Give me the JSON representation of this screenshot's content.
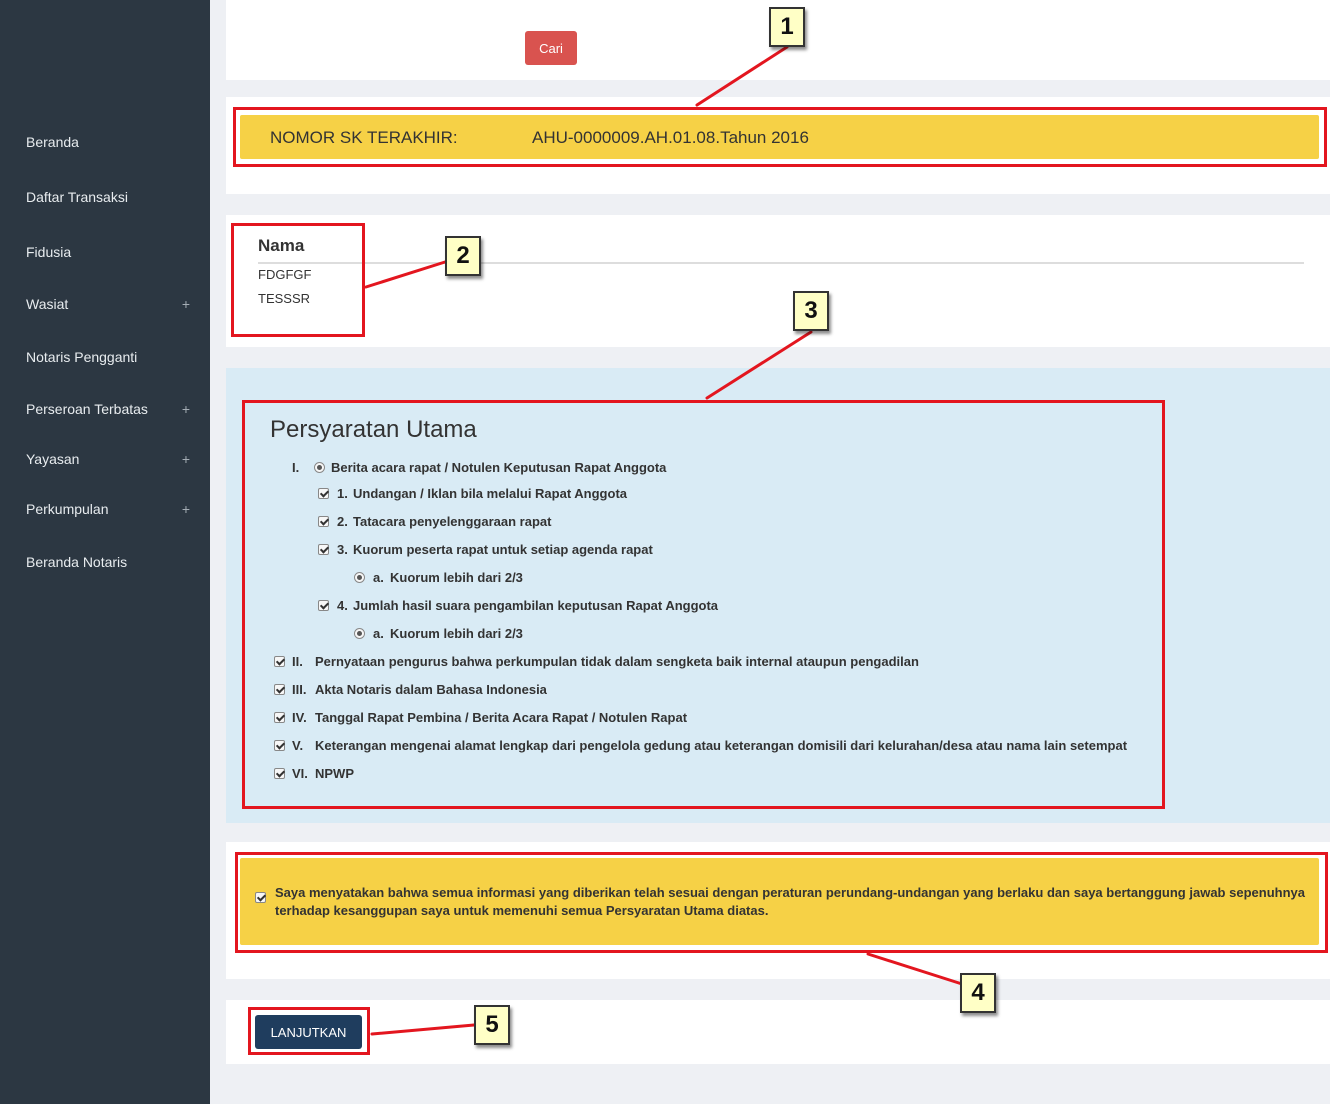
{
  "sidebar": {
    "items": [
      {
        "label": "Beranda",
        "expandable": false
      },
      {
        "label": "Daftar Transaksi",
        "expandable": false
      },
      {
        "label": "Fidusia",
        "expandable": false
      },
      {
        "label": "Wasiat",
        "expandable": true
      },
      {
        "label": "Notaris Pengganti",
        "expandable": false
      },
      {
        "label": "Perseroan Terbatas",
        "expandable": true
      },
      {
        "label": "Yayasan",
        "expandable": true
      },
      {
        "label": "Perkumpulan",
        "expandable": true
      },
      {
        "label": "Beranda Notaris",
        "expandable": false
      }
    ],
    "expand_symbol": "+"
  },
  "search": {
    "button_label": "Cari"
  },
  "sk": {
    "label": "NOMOR SK TERAKHIR:",
    "value": "AHU-0000009.AH.01.08.Tahun 2016"
  },
  "nama": {
    "header": "Nama",
    "rows": [
      "FDGFGF",
      "TESSSR"
    ]
  },
  "requirements": {
    "title": "Persyaratan Utama",
    "items": [
      {
        "control": "none",
        "number": "I.",
        "text": ""
      },
      {
        "control": "radio",
        "checked": true,
        "number": "",
        "text": "Berita acara rapat / Notulen Keputusan Rapat Anggota"
      },
      {
        "control": "checkbox",
        "checked": true,
        "number": "1.",
        "text": "Undangan / Iklan bila melalui Rapat Anggota"
      },
      {
        "control": "checkbox",
        "checked": true,
        "number": "2.",
        "text": "Tatacara penyelenggaraan rapat"
      },
      {
        "control": "checkbox",
        "checked": true,
        "number": "3.",
        "text": "Kuorum peserta rapat untuk setiap agenda rapat"
      },
      {
        "control": "radio",
        "checked": true,
        "number": "a.",
        "text": "Kuorum lebih dari 2/3"
      },
      {
        "control": "checkbox",
        "checked": true,
        "number": "4.",
        "text": "Jumlah hasil suara pengambilan keputusan Rapat Anggota"
      },
      {
        "control": "radio",
        "checked": true,
        "number": "a.",
        "text": "Kuorum lebih dari 2/3"
      },
      {
        "control": "checkbox",
        "checked": true,
        "number": "II.",
        "text": "Pernyataan pengurus bahwa perkumpulan tidak dalam sengketa baik internal ataupun pengadilan"
      },
      {
        "control": "checkbox",
        "checked": true,
        "number": "III.",
        "text": "Akta Notaris dalam Bahasa Indonesia"
      },
      {
        "control": "checkbox",
        "checked": true,
        "number": "IV.",
        "text": "Tanggal Rapat Pembina / Berita Acara Rapat / Notulen Rapat"
      },
      {
        "control": "checkbox",
        "checked": true,
        "number": "V.",
        "text": "Keterangan mengenai alamat lengkap dari pengelola gedung atau keterangan domisili dari kelurahan/desa atau nama lain setempat"
      },
      {
        "control": "checkbox",
        "checked": true,
        "number": "VI.",
        "text": "NPWP"
      }
    ]
  },
  "declaration": {
    "checked": true,
    "text": "Saya menyatakan bahwa semua informasi yang diberikan telah sesuai dengan peraturan perundang-undangan yang berlaku dan saya bertanggung jawab sepenuhnya terhadap kesanggupan saya untuk memenuhi semua Persyaratan Utama diatas."
  },
  "continue_button": {
    "label": "LANJUTKAN"
  },
  "callouts": [
    "1",
    "2",
    "3",
    "4",
    "5"
  ],
  "colors": {
    "sidebar_bg": "#2c3742",
    "warning_yellow": "#f6d146",
    "info_blue": "#d9ebf5",
    "danger_red": "#d9534f",
    "primary_navy": "#1f3d5e",
    "annotation_red": "#e3161f",
    "callout_bg": "#ffffc6"
  }
}
